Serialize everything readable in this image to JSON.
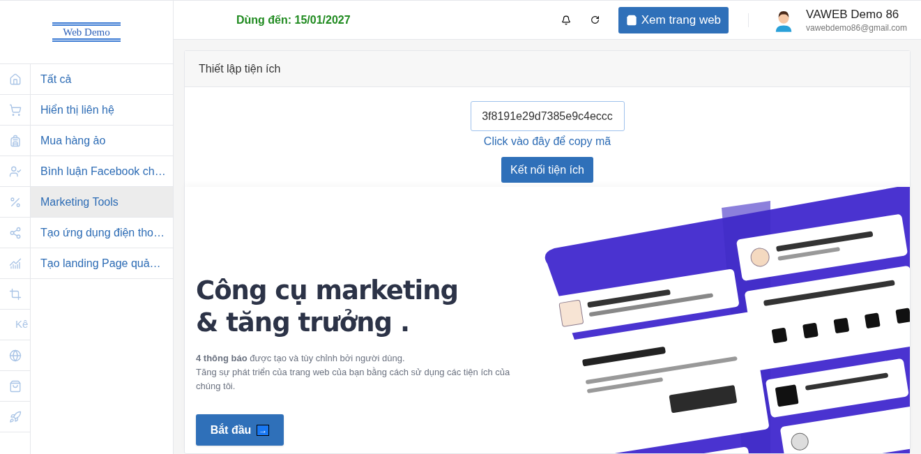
{
  "logo": {
    "text": "Web Demo"
  },
  "sidebar": {
    "icon_rail": [
      {
        "kind": "icon"
      },
      {
        "kind": "icon"
      },
      {
        "kind": "icon"
      },
      {
        "kind": "icon"
      },
      {
        "kind": "icon"
      },
      {
        "kind": "icon"
      },
      {
        "kind": "icon"
      },
      {
        "kind": "icon"
      },
      {
        "kind": "text",
        "label": "Kê"
      },
      {
        "kind": "icon"
      },
      {
        "kind": "icon"
      },
      {
        "kind": "icon"
      }
    ],
    "items": [
      {
        "label": "Tất cả",
        "selected": false
      },
      {
        "label": "Hiển thị liên hệ",
        "selected": false
      },
      {
        "label": "Mua hàng ảo",
        "selected": false
      },
      {
        "label": "Bình luận Facebook ch…",
        "selected": false
      },
      {
        "label": "Marketing Tools",
        "selected": true
      },
      {
        "label": "Tạo ứng dụng điện tho…",
        "selected": false
      },
      {
        "label": "Tạo landing Page quả…",
        "selected": false
      }
    ]
  },
  "header": {
    "expiry": "Dùng đến: 15/01/2027",
    "view_site_button": "Xem trang web",
    "user": {
      "name": "VAWEB Demo 86",
      "email": "vawebdemo86@gmail.com"
    }
  },
  "panel": {
    "title": "Thiết lập tiện ích",
    "code_field": {
      "value": "3f8191e29d7385e9c4eccc"
    },
    "copy_link": "Click vào đây để copy mã",
    "connect_button": "Kết nối tiện ích"
  },
  "hero": {
    "title_lines": [
      "Công cụ marketing",
      "& tăng trưởng ."
    ],
    "description_lines": [
      "**4 thông báo** được tạo và tùy chỉnh bởi người dùng.",
      "Tăng sự phát triển của trang web của bạn bằng cách sử dụng các tiện ích của chúng tôi."
    ],
    "start_button": "Bắt đầu",
    "start_button_icon": "→"
  }
}
